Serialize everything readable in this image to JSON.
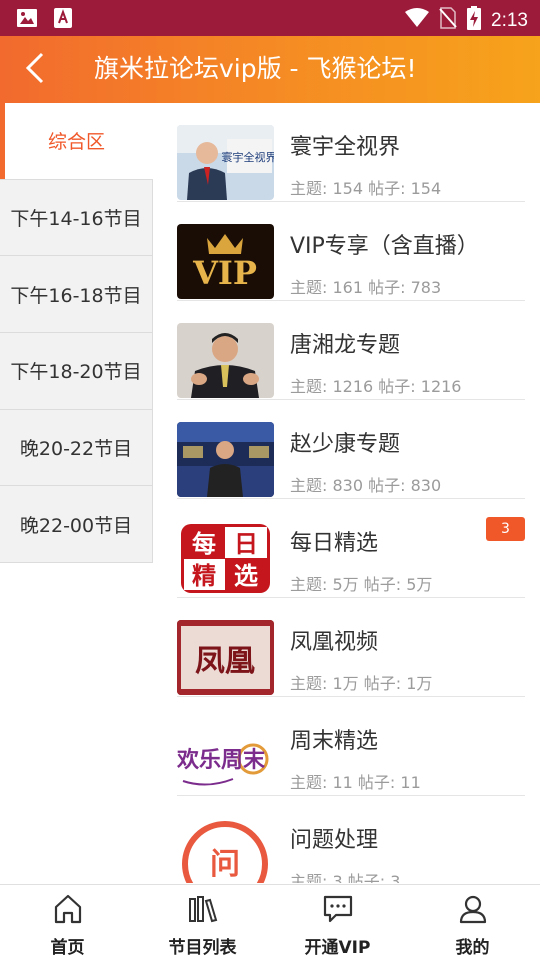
{
  "status": {
    "time": "2:13"
  },
  "header": {
    "title": "旗米拉论坛vip版 - 飞猴论坛!"
  },
  "sidebar": {
    "items": [
      {
        "label": "综合区"
      },
      {
        "label": "下午14-16节目"
      },
      {
        "label": "下午16-18节目"
      },
      {
        "label": "下午18-20节目"
      },
      {
        "label": "晚20-22节目"
      },
      {
        "label": "晚22-00节目"
      }
    ]
  },
  "forums": [
    {
      "title": "寰宇全视界",
      "meta": "主题: 154 帖子: 154"
    },
    {
      "title": "VIP专享（含直播）",
      "meta": "主题: 161 帖子: 783"
    },
    {
      "title": "唐湘龙专题",
      "meta": "主题: 1216 帖子: 1216"
    },
    {
      "title": "赵少康专题",
      "meta": "主题: 830 帖子: 830"
    },
    {
      "title": "每日精选",
      "meta": "主题: 5万 帖子: 5万",
      "badge": "3"
    },
    {
      "title": "凤凰视频",
      "meta": "主题: 1万 帖子: 1万"
    },
    {
      "title": "周末精选",
      "meta": "主题: 11 帖子: 11"
    },
    {
      "title": "问题处理",
      "meta": "主题: 3 帖子: 3"
    }
  ],
  "thumb_text": {
    "huanyu": "寰宇全视界",
    "vip": "VIP",
    "meiri": [
      "每",
      "日",
      "精",
      "选"
    ],
    "fenghuang": "凤凰",
    "zhoumo": "欢乐周末",
    "wenti": "问"
  },
  "tabs": [
    {
      "label": "首页",
      "icon": "home-icon"
    },
    {
      "label": "节目列表",
      "icon": "books-icon"
    },
    {
      "label": "开通VIP",
      "icon": "chat-icon"
    },
    {
      "label": "我的",
      "icon": "user-icon"
    }
  ],
  "colors": {
    "accent": "#f0582a",
    "status_bar": "#9c1b3a",
    "header_start": "#f26a2e",
    "header_end": "#f7a31b"
  }
}
